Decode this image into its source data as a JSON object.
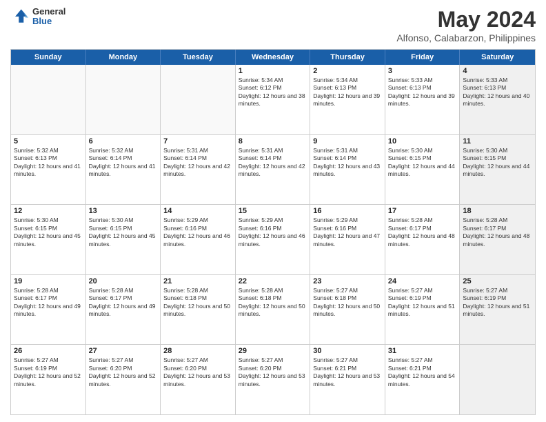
{
  "logo": {
    "general": "General",
    "blue": "Blue"
  },
  "title": "May 2024",
  "location": "Alfonso, Calabarzon, Philippines",
  "weekdays": [
    "Sunday",
    "Monday",
    "Tuesday",
    "Wednesday",
    "Thursday",
    "Friday",
    "Saturday"
  ],
  "rows": [
    [
      {
        "day": "",
        "empty": true
      },
      {
        "day": "",
        "empty": true
      },
      {
        "day": "",
        "empty": true
      },
      {
        "day": "1",
        "sunrise": "Sunrise: 5:34 AM",
        "sunset": "Sunset: 6:12 PM",
        "daylight": "Daylight: 12 hours and 38 minutes."
      },
      {
        "day": "2",
        "sunrise": "Sunrise: 5:34 AM",
        "sunset": "Sunset: 6:13 PM",
        "daylight": "Daylight: 12 hours and 39 minutes."
      },
      {
        "day": "3",
        "sunrise": "Sunrise: 5:33 AM",
        "sunset": "Sunset: 6:13 PM",
        "daylight": "Daylight: 12 hours and 39 minutes."
      },
      {
        "day": "4",
        "sunrise": "Sunrise: 5:33 AM",
        "sunset": "Sunset: 6:13 PM",
        "daylight": "Daylight: 12 hours and 40 minutes.",
        "shaded": true
      }
    ],
    [
      {
        "day": "5",
        "sunrise": "Sunrise: 5:32 AM",
        "sunset": "Sunset: 6:13 PM",
        "daylight": "Daylight: 12 hours and 41 minutes."
      },
      {
        "day": "6",
        "sunrise": "Sunrise: 5:32 AM",
        "sunset": "Sunset: 6:14 PM",
        "daylight": "Daylight: 12 hours and 41 minutes."
      },
      {
        "day": "7",
        "sunrise": "Sunrise: 5:31 AM",
        "sunset": "Sunset: 6:14 PM",
        "daylight": "Daylight: 12 hours and 42 minutes."
      },
      {
        "day": "8",
        "sunrise": "Sunrise: 5:31 AM",
        "sunset": "Sunset: 6:14 PM",
        "daylight": "Daylight: 12 hours and 42 minutes."
      },
      {
        "day": "9",
        "sunrise": "Sunrise: 5:31 AM",
        "sunset": "Sunset: 6:14 PM",
        "daylight": "Daylight: 12 hours and 43 minutes."
      },
      {
        "day": "10",
        "sunrise": "Sunrise: 5:30 AM",
        "sunset": "Sunset: 6:15 PM",
        "daylight": "Daylight: 12 hours and 44 minutes."
      },
      {
        "day": "11",
        "sunrise": "Sunrise: 5:30 AM",
        "sunset": "Sunset: 6:15 PM",
        "daylight": "Daylight: 12 hours and 44 minutes.",
        "shaded": true
      }
    ],
    [
      {
        "day": "12",
        "sunrise": "Sunrise: 5:30 AM",
        "sunset": "Sunset: 6:15 PM",
        "daylight": "Daylight: 12 hours and 45 minutes."
      },
      {
        "day": "13",
        "sunrise": "Sunrise: 5:30 AM",
        "sunset": "Sunset: 6:15 PM",
        "daylight": "Daylight: 12 hours and 45 minutes."
      },
      {
        "day": "14",
        "sunrise": "Sunrise: 5:29 AM",
        "sunset": "Sunset: 6:16 PM",
        "daylight": "Daylight: 12 hours and 46 minutes."
      },
      {
        "day": "15",
        "sunrise": "Sunrise: 5:29 AM",
        "sunset": "Sunset: 6:16 PM",
        "daylight": "Daylight: 12 hours and 46 minutes."
      },
      {
        "day": "16",
        "sunrise": "Sunrise: 5:29 AM",
        "sunset": "Sunset: 6:16 PM",
        "daylight": "Daylight: 12 hours and 47 minutes."
      },
      {
        "day": "17",
        "sunrise": "Sunrise: 5:28 AM",
        "sunset": "Sunset: 6:17 PM",
        "daylight": "Daylight: 12 hours and 48 minutes."
      },
      {
        "day": "18",
        "sunrise": "Sunrise: 5:28 AM",
        "sunset": "Sunset: 6:17 PM",
        "daylight": "Daylight: 12 hours and 48 minutes.",
        "shaded": true
      }
    ],
    [
      {
        "day": "19",
        "sunrise": "Sunrise: 5:28 AM",
        "sunset": "Sunset: 6:17 PM",
        "daylight": "Daylight: 12 hours and 49 minutes."
      },
      {
        "day": "20",
        "sunrise": "Sunrise: 5:28 AM",
        "sunset": "Sunset: 6:17 PM",
        "daylight": "Daylight: 12 hours and 49 minutes."
      },
      {
        "day": "21",
        "sunrise": "Sunrise: 5:28 AM",
        "sunset": "Sunset: 6:18 PM",
        "daylight": "Daylight: 12 hours and 50 minutes."
      },
      {
        "day": "22",
        "sunrise": "Sunrise: 5:28 AM",
        "sunset": "Sunset: 6:18 PM",
        "daylight": "Daylight: 12 hours and 50 minutes."
      },
      {
        "day": "23",
        "sunrise": "Sunrise: 5:27 AM",
        "sunset": "Sunset: 6:18 PM",
        "daylight": "Daylight: 12 hours and 50 minutes."
      },
      {
        "day": "24",
        "sunrise": "Sunrise: 5:27 AM",
        "sunset": "Sunset: 6:19 PM",
        "daylight": "Daylight: 12 hours and 51 minutes."
      },
      {
        "day": "25",
        "sunrise": "Sunrise: 5:27 AM",
        "sunset": "Sunset: 6:19 PM",
        "daylight": "Daylight: 12 hours and 51 minutes.",
        "shaded": true
      }
    ],
    [
      {
        "day": "26",
        "sunrise": "Sunrise: 5:27 AM",
        "sunset": "Sunset: 6:19 PM",
        "daylight": "Daylight: 12 hours and 52 minutes."
      },
      {
        "day": "27",
        "sunrise": "Sunrise: 5:27 AM",
        "sunset": "Sunset: 6:20 PM",
        "daylight": "Daylight: 12 hours and 52 minutes."
      },
      {
        "day": "28",
        "sunrise": "Sunrise: 5:27 AM",
        "sunset": "Sunset: 6:20 PM",
        "daylight": "Daylight: 12 hours and 53 minutes."
      },
      {
        "day": "29",
        "sunrise": "Sunrise: 5:27 AM",
        "sunset": "Sunset: 6:20 PM",
        "daylight": "Daylight: 12 hours and 53 minutes."
      },
      {
        "day": "30",
        "sunrise": "Sunrise: 5:27 AM",
        "sunset": "Sunset: 6:21 PM",
        "daylight": "Daylight: 12 hours and 53 minutes."
      },
      {
        "day": "31",
        "sunrise": "Sunrise: 5:27 AM",
        "sunset": "Sunset: 6:21 PM",
        "daylight": "Daylight: 12 hours and 54 minutes."
      },
      {
        "day": "",
        "empty": true,
        "shaded": true
      }
    ]
  ]
}
